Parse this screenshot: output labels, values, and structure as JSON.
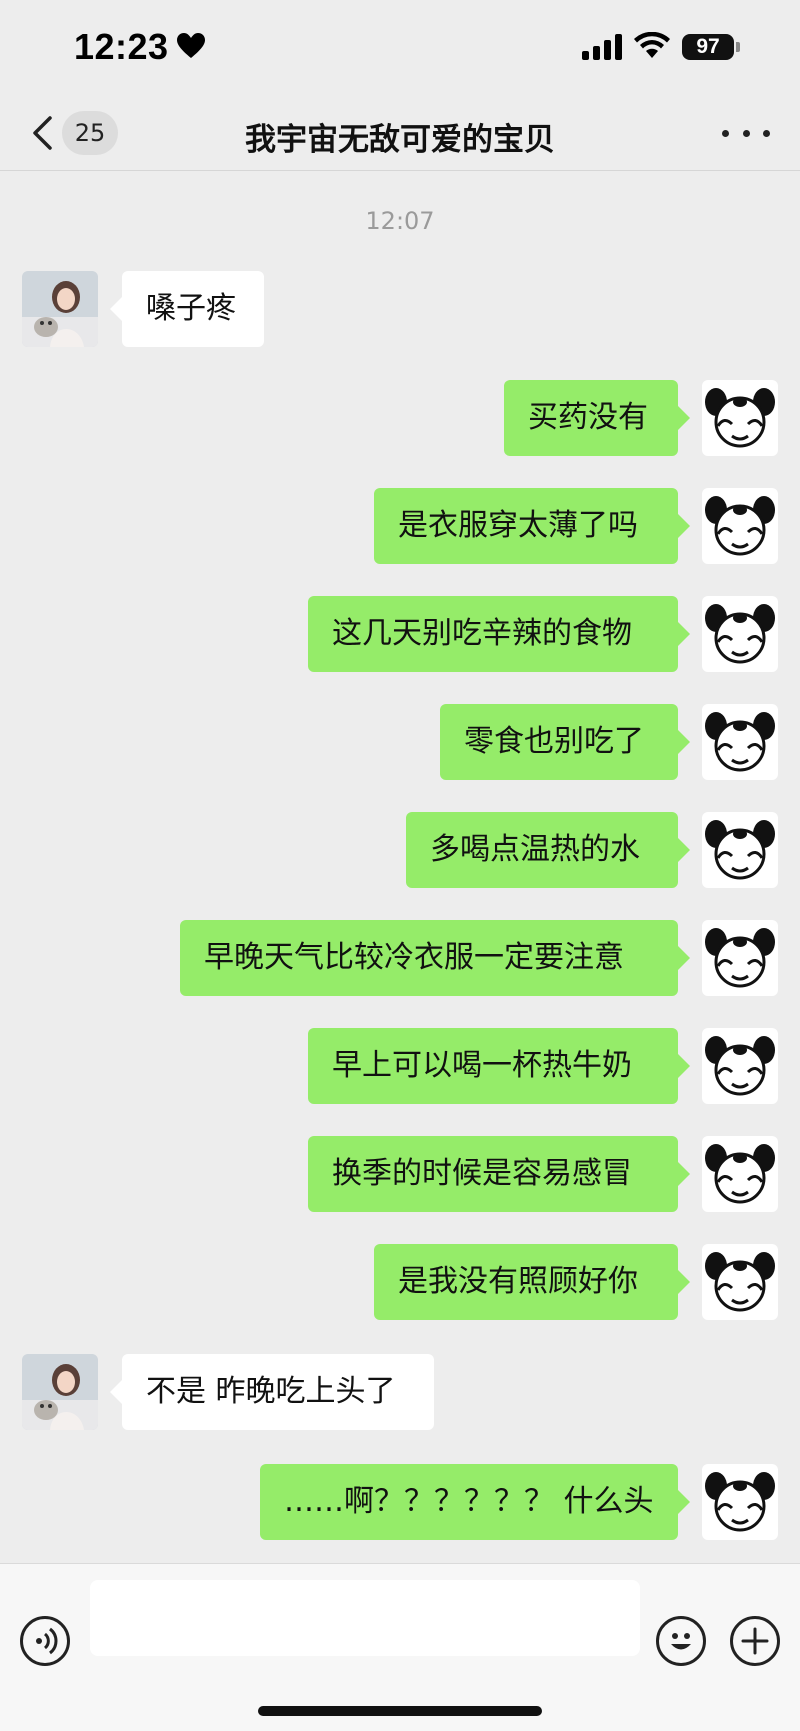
{
  "status_bar": {
    "time": "12:23",
    "battery": "97"
  },
  "nav": {
    "unread_count": "25",
    "title": "我宇宙无敌可爱的宝贝"
  },
  "timestamp": "12:07",
  "messages": [
    {
      "side": "in",
      "text": "嗓子疼"
    },
    {
      "side": "out",
      "text": "买药没有"
    },
    {
      "side": "out",
      "text": "是衣服穿太薄了吗"
    },
    {
      "side": "out",
      "text": "这几天别吃辛辣的食物"
    },
    {
      "side": "out",
      "text": "零食也别吃了"
    },
    {
      "side": "out",
      "text": "多喝点温热的水"
    },
    {
      "side": "out",
      "text": "早晚天气比较冷衣服一定要注意"
    },
    {
      "side": "out",
      "text": "早上可以喝一杯热牛奶"
    },
    {
      "side": "out",
      "text": "换季的时候是容易感冒"
    },
    {
      "side": "out",
      "text": "是我没有照顾好你"
    },
    {
      "side": "in",
      "text": "不是 昨晚吃上头了"
    },
    {
      "side": "out",
      "text": "……啊？？？？？？ 什么头"
    }
  ],
  "input": {
    "placeholder": ""
  },
  "colors": {
    "outgoing_bubble": "#95ec69",
    "incoming_bubble": "#ffffff",
    "background": "#ededed"
  },
  "icons": {
    "back": "chevron-left-icon",
    "more": "more-icon",
    "voice": "voice-icon",
    "emoji": "emoji-icon",
    "plus": "plus-icon",
    "heart": "heart-icon",
    "signal": "signal-icon",
    "wifi": "wifi-icon",
    "battery": "battery-icon"
  }
}
